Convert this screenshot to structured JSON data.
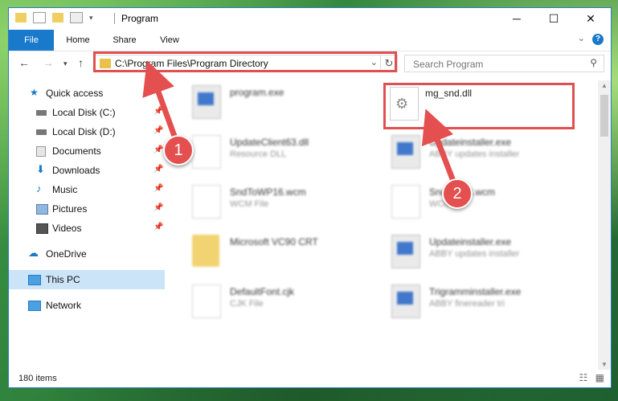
{
  "window": {
    "title": "Program",
    "minimize": "─",
    "maximize": "☐",
    "close": "✕"
  },
  "ribbon": {
    "tabs": [
      "File",
      "Home",
      "Share",
      "View"
    ],
    "help": "?"
  },
  "nav": {
    "address": "C:\\Program Files\\Program Directory",
    "search_placeholder": "Search Program"
  },
  "sidebar": {
    "items": [
      {
        "label": "Quick access",
        "icon": "star-icon"
      },
      {
        "label": "Local Disk (C:)",
        "icon": "drive-icon",
        "pinned": true
      },
      {
        "label": "Local Disk (D:)",
        "icon": "drive-icon",
        "pinned": true
      },
      {
        "label": "Documents",
        "icon": "documents-icon",
        "pinned": true
      },
      {
        "label": "Downloads",
        "icon": "download-icon",
        "pinned": true
      },
      {
        "label": "Music",
        "icon": "music-icon",
        "pinned": true
      },
      {
        "label": "Pictures",
        "icon": "pictures-icon",
        "pinned": true
      },
      {
        "label": "Videos",
        "icon": "video-icon",
        "pinned": true
      },
      {
        "label": "OneDrive",
        "icon": "cloud-icon"
      },
      {
        "label": "This PC",
        "icon": "pc-icon",
        "selected": true
      },
      {
        "label": "Network",
        "icon": "network-icon"
      }
    ]
  },
  "files": [
    {
      "name": "program.exe",
      "desc": ""
    },
    {
      "name": "mg_snd.dll",
      "desc": ""
    },
    {
      "name": "UpdateClient63.dll",
      "desc": "Resource DLL"
    },
    {
      "name": "Updateinstaller.exe",
      "desc": "ABBY updates installer"
    },
    {
      "name": "SndToWP16.wcm",
      "desc": "WCM File"
    },
    {
      "name": "Snd",
      "name2": "3.wcm",
      "desc": "WCM"
    },
    {
      "name": "Microsoft VC90 CRT",
      "desc": ""
    },
    {
      "name": "Updateinstaller.exe",
      "desc": "ABBY updates installer"
    },
    {
      "name": "DefaultFont.cjk",
      "desc": "CJK File"
    },
    {
      "name": "Trigramminstaller.exe",
      "desc": "ABBY finereader tri"
    }
  ],
  "status": {
    "items_count": "180 items"
  },
  "annotations": {
    "badge1": "1",
    "badge2": "2",
    "color": "#e44f4f"
  }
}
